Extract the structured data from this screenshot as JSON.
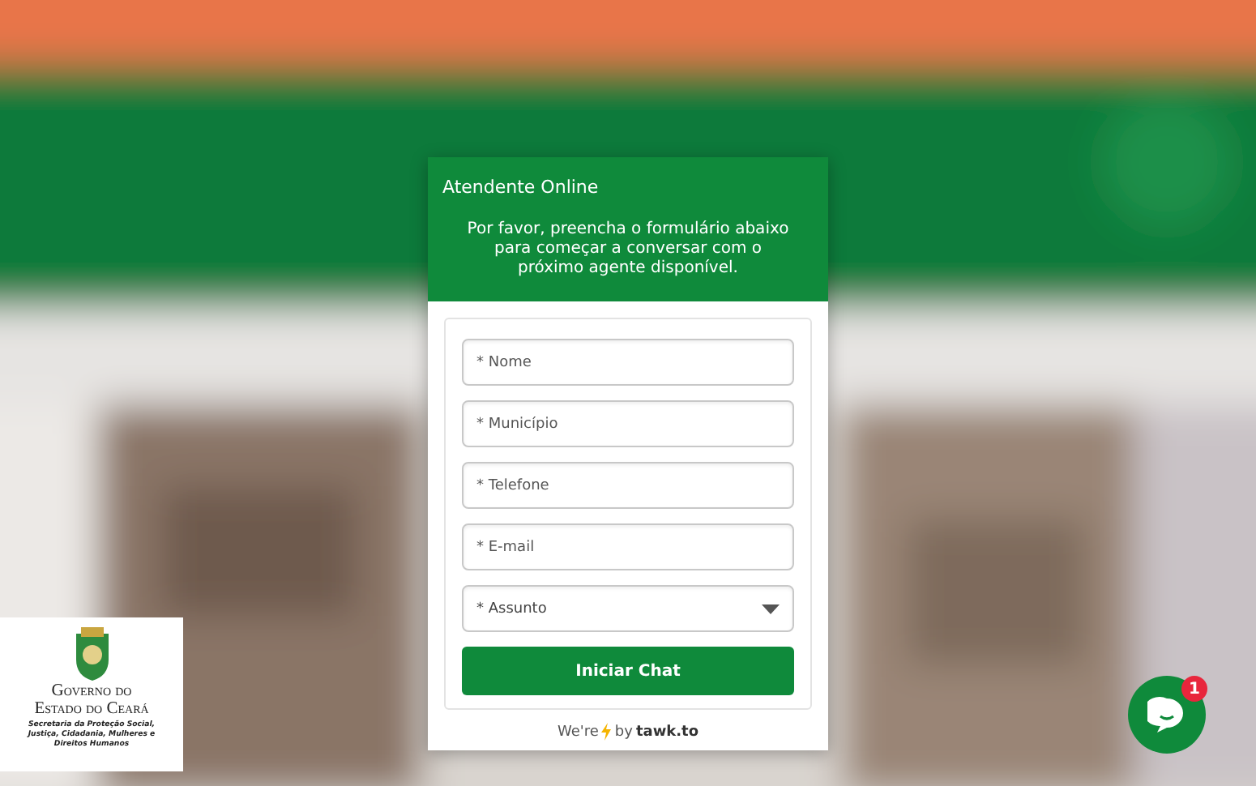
{
  "chat_widget": {
    "title": "Atendente Online",
    "message": "Por favor, preencha o formulário abaixo para começar a conversar com o próximo agente disponível.",
    "fields": [
      {
        "kind": "text",
        "placeholder": "* Nome"
      },
      {
        "kind": "text",
        "placeholder": "* Município"
      },
      {
        "kind": "text",
        "placeholder": "* Telefone"
      },
      {
        "kind": "text",
        "placeholder": "* E-mail"
      },
      {
        "kind": "select",
        "placeholder": "* Assunto"
      }
    ],
    "submit_button": "Iniciar Chat",
    "footer": {
      "prefix": "We're",
      "by": "by",
      "brand": "tawk.to"
    }
  },
  "logo": {
    "line_1": "Governo do",
    "line_2": "Estado do Ceará",
    "subtitle": "Secretaria da Proteção Social, Justiça, Cidadania, Mulheres e Direitos Humanos"
  },
  "chat_launcher": {
    "badge": "1"
  }
}
